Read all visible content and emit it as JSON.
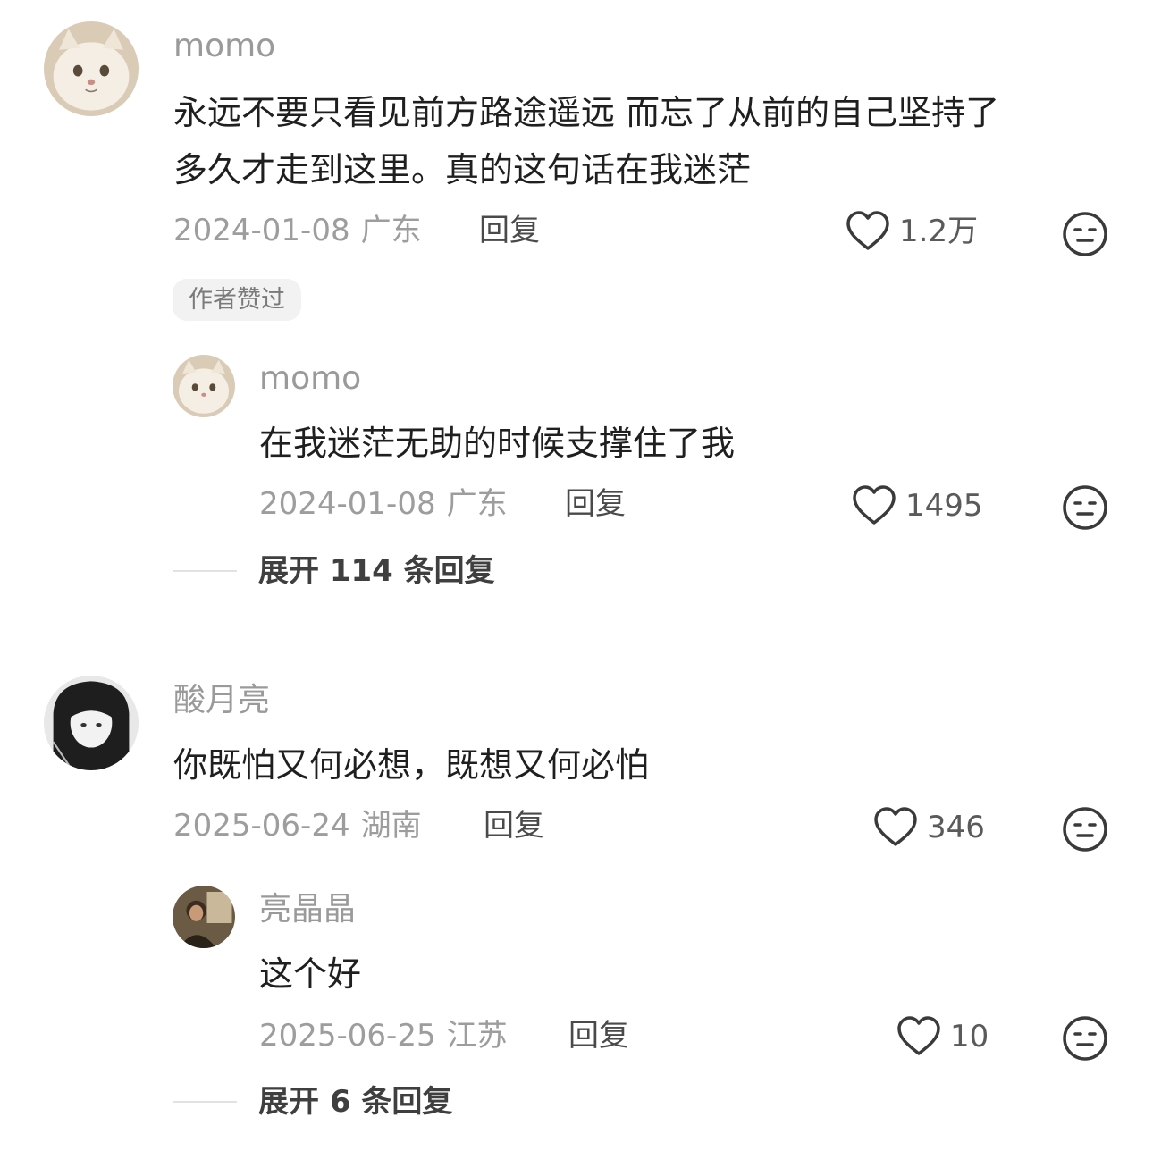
{
  "comments": [
    {
      "username": "momo",
      "text_lines": [
        "永远不要只看见前方路途遥远 而忘了从前的自己坚持了",
        "多久才走到这里。真的这句话在我迷茫"
      ],
      "date": "2024-01-08",
      "region": "广东",
      "reply_label": "回复",
      "likes": "1.2万",
      "badge": "作者赞过",
      "avatar_icon": "cat-avatar-icon",
      "replies": [
        {
          "username": "momo",
          "text": "在我迷茫无助的时候支撑住了我",
          "date": "2024-01-08",
          "region": "广东",
          "reply_label": "回复",
          "likes": "1495",
          "avatar_icon": "cat-avatar-icon"
        }
      ],
      "expand_label": "展开 114 条回复"
    },
    {
      "username": "酸月亮",
      "text_lines": [
        "你既怕又何必想，既想又何必怕"
      ],
      "date": "2025-06-24",
      "region": "湖南",
      "reply_label": "回复",
      "likes": "346",
      "avatar_icon": "girl-avatar-icon",
      "replies": [
        {
          "username": "亮晶晶",
          "text": "这个好",
          "date": "2025-06-25",
          "region": "江苏",
          "reply_label": "回复",
          "likes": "10",
          "avatar_icon": "person-avatar-icon"
        }
      ],
      "expand_label": "展开 6 条回复"
    }
  ],
  "icons": {
    "like": "heart-outline-icon",
    "dislike": "meh-face-icon"
  },
  "colors": {
    "meta_gray": "#9d9d9d",
    "text_dark": "#1f1f1f",
    "badge_bg": "#f2f2f2"
  }
}
